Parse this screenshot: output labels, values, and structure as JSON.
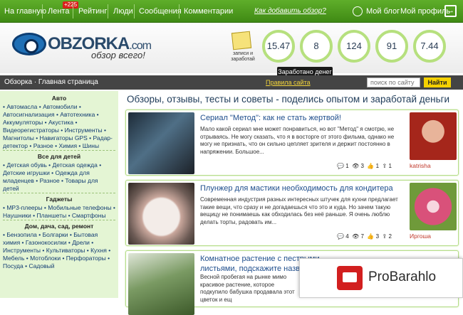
{
  "nav": {
    "items": [
      "На главную",
      "Лента",
      "Рейтинг",
      "Люди",
      "Сообщения",
      "Комментарии"
    ],
    "badge": "+225",
    "howto": "Как добавить обзор?",
    "blog": "Мой блог",
    "profile": "Мой профиль"
  },
  "header": {
    "logo_name": "OBZORKA",
    "logo_com": ".com",
    "slogan": "обзор всего!",
    "notes_label": "записи и заработай",
    "stats": [
      "15.47",
      "8",
      "124",
      "91",
      "7.44"
    ],
    "tooltip": "Заработано денег"
  },
  "subbar": {
    "crumb": "Обзорка · Главная страница",
    "rules": "Правила сайта",
    "search_placeholder": "поиск по сайту",
    "search_button": "Найти"
  },
  "sidebar": {
    "categories": [
      {
        "title": "Авто",
        "items": "• Автомасла • Автомобили • Автосигнализация • Автотехника • Аккумуляторы • Акустика • Видеорегистраторы • Инструменты • Магнитолы • Навигаторы GPS • Радар-детектор • Разное • Химия • Шины"
      },
      {
        "title": "Все для детей",
        "items": "• Детская обувь • Детская одежда • Детские игрушки • Одежда для младенцев • Разное • Товары для детей"
      },
      {
        "title": "Гаджеты",
        "items": "• MP3-плееры • Мобильные телефоны • Наушники • Планшеты • Смартфоны"
      },
      {
        "title": "Дом, дача, сад, ремонт",
        "items": "• Бензопила • Болгарки • Бытовая химия • Газонокосилки • Дрели • Инструменты • Культиваторы • Кухня • Мебель • Мотоблоки • Перфораторы • Посуда • Садовый"
      }
    ]
  },
  "main": {
    "title": "Обзоры, отзывы, тесты и советы - поделись опытом и заработай деньги",
    "cards": [
      {
        "title": "Сериал \"Метод\": как не стать жертвой!",
        "text": "Мало какой сериал мне может понравиться, но вот \"Метод\" я смотрю, не отрываясь. Не могу сказать, что я в восторге от этого фильма, однако не могу не признать, что он сильно цепляет зрителя и держит постоянно в напряжении. Большое...",
        "author": "katrisha",
        "comments": "1",
        "views": "3",
        "likes": "1"
      },
      {
        "title": "Плунжер для мастики необходимость для кондитера",
        "text": "Современная индустрия разных интересных штучек для кухни предлагает такие вещи, что сразу и не догадаешься что это и куда. Но зачем такую вещицу не понимаешь как обходилась без неё раньше. Я очень люблю делать торты, радовать им...",
        "author": "Иргоша",
        "comments": "4",
        "views": "7",
        "likes": "3"
      },
      {
        "title": "Комнатное растение с пестрыми листьями, подскажите название",
        "text": "Весной пробегая на рынке мимо красивое растение, которое подкупило бабушка продавала этот цветок и ещ",
        "author": "",
        "comments": "",
        "views": "",
        "likes": ""
      }
    ]
  },
  "ad": {
    "text": "ProBarahlo"
  },
  "colors": {
    "nav_green": "#4e9d1f",
    "sidebar_bg": "#e4f5d4",
    "link_blue": "#1f4e8c",
    "accent_yellow": "#f5d100"
  }
}
